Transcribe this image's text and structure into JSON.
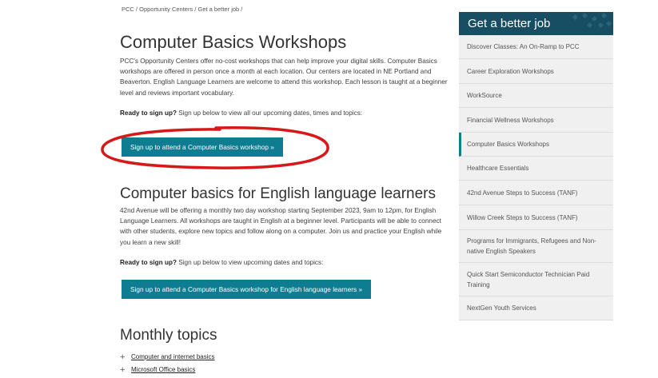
{
  "breadcrumb": [
    "PCC",
    "Opportunity Centers",
    "Get a better job"
  ],
  "breadcrumb_separator": " / ",
  "main": {
    "title": "Computer Basics Workshops",
    "intro": "PCC's Opportunity Centers offer no-cost workshops that can help improve your digital skills. Computer Basics workshops are offered in person once a month at each location. Our centers are located in NE Portland and Beaverton. English Language Learners are welcome to attend this workshop. Each lesson is taught at a beginner level and reviews important vocabulary.",
    "ready_bold": "Ready to sign up?",
    "ready_rest": " Sign up below to view all our upcoming dates, times and topics:",
    "button": "Sign up to attend a Computer Basics workshop »"
  },
  "ell": {
    "title": "Computer basics for English language learners",
    "text": "42nd Avenue will be offering a monthly two day workshop starting September 2023, 9am to 12pm, for English Language Learners. All workshops are taught in English at a beginner level. Participants will be able to connect with other students, explore new topics and follow along on a computer. Join us and practice your English while you learn a new skill!",
    "ready_bold": "Ready to sign up?",
    "ready_rest": " Sign up below to view upcoming dates and topics:",
    "button": "Sign up to attend a Computer Basics workshop for English language learners »"
  },
  "monthly": {
    "title": "Monthly topics",
    "items": [
      {
        "label": "Computer and internet basics",
        "icon": "plus-icon"
      },
      {
        "label": "Microsoft Office basics",
        "icon": "plus-icon"
      }
    ]
  },
  "sidebar": {
    "title": "Get a better job",
    "items": [
      {
        "label": "Discover Classes: An On-Ramp to PCC"
      },
      {
        "label": "Career Exploration Workshops"
      },
      {
        "label": "WorkSource"
      },
      {
        "label": "Financial Wellness Workshops"
      },
      {
        "label": "Computer Basics Workshops",
        "active": true
      },
      {
        "label": "Healthcare Essentials"
      },
      {
        "label": "42nd Avenue Steps to Success (TANF)"
      },
      {
        "label": "Willow Creek Steps to Success (TANF)"
      },
      {
        "label": "Programs for Immigrants, Refugees and Non-native English Speakers"
      },
      {
        "label": "Quick Start Semiconductor Technician Paid Training"
      },
      {
        "label": "NextGen Youth Services"
      }
    ]
  },
  "colors": {
    "button": "#0f7d91",
    "sidebar_header": "#184e63",
    "sidebar_bg": "#f0f0f0",
    "annotation_ellipse": "#d81818"
  }
}
